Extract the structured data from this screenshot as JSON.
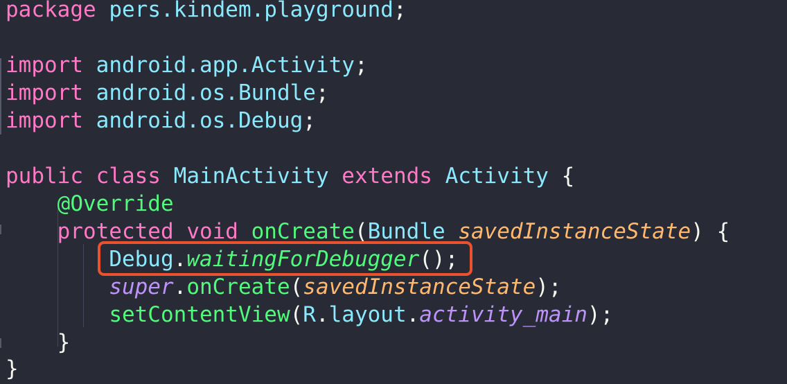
{
  "editor": {
    "lines": [
      {
        "tokens": [
          "package",
          " ",
          "pers.kindem.playground",
          ";"
        ]
      },
      {
        "tokens": []
      },
      {
        "tokens": [
          "import",
          " ",
          "android.app.Activity",
          ";"
        ]
      },
      {
        "tokens": [
          "import",
          " ",
          "android.os.Bundle",
          ";"
        ]
      },
      {
        "tokens": [
          "import",
          " ",
          "android.os.Debug",
          ";"
        ]
      },
      {
        "tokens": []
      },
      {
        "tokens": [
          "public",
          " ",
          "class",
          " ",
          "MainActivity",
          " ",
          "extends",
          " ",
          "Activity",
          " ",
          "{"
        ]
      },
      {
        "tokens": [
          "    ",
          "@Override"
        ]
      },
      {
        "tokens": [
          "    ",
          "protected",
          " ",
          "void",
          " ",
          "onCreate",
          "(",
          "Bundle",
          " ",
          "savedInstanceState",
          ")",
          " ",
          "{"
        ]
      },
      {
        "tokens": [
          "        ",
          "Debug",
          ".",
          "waitingForDebugger",
          "();"
        ]
      },
      {
        "tokens": [
          "        ",
          "super",
          ".",
          "onCreate",
          "(",
          "savedInstanceState",
          ");"
        ]
      },
      {
        "tokens": [
          "        ",
          "setContentView",
          "(",
          "R",
          ".",
          "layout",
          ".",
          "activity_main",
          ");"
        ]
      },
      {
        "tokens": [
          "    ",
          "}"
        ]
      },
      {
        "tokens": [
          "}"
        ]
      }
    ]
  },
  "colors": {
    "background": "#282a36",
    "keyword": "#ff79c6",
    "type": "#8be9fd",
    "function": "#50fa7b",
    "parameter": "#ffb86c",
    "constant": "#bd93f9",
    "highlight_border": "#e9522c"
  }
}
